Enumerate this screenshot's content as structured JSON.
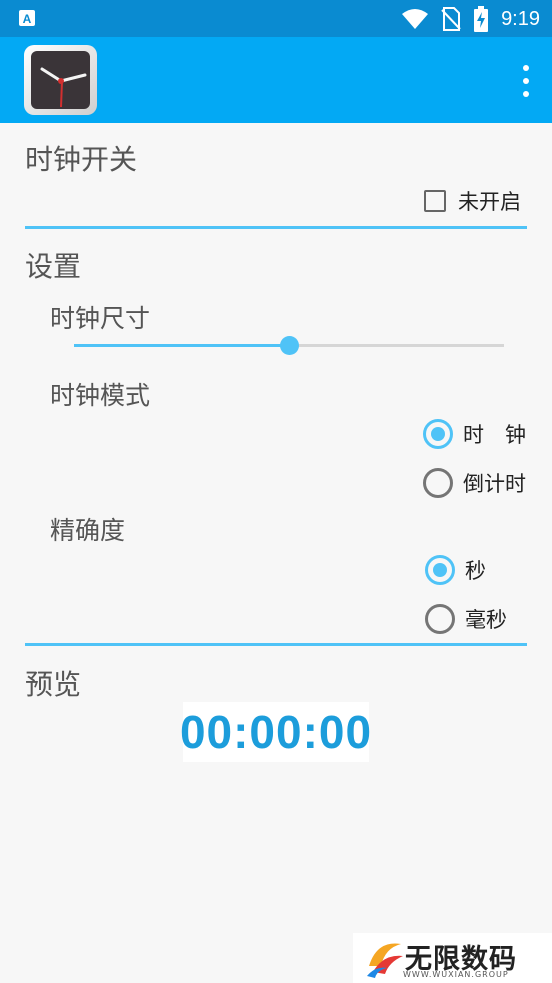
{
  "status_bar": {
    "time": "9:19",
    "icons": [
      "app-notification-icon",
      "wifi-icon",
      "no-sim-icon",
      "battery-charging-icon"
    ]
  },
  "app_bar": {
    "app_icon": "clock-app-icon",
    "overflow_icon": "more-vert-icon"
  },
  "clock_switch": {
    "title": "时钟开关",
    "checkbox_label": "未开启",
    "checked": false
  },
  "settings": {
    "title": "设置",
    "clock_size": {
      "label": "时钟尺寸",
      "value_fraction": 0.5
    },
    "clock_mode": {
      "label": "时钟模式",
      "options": [
        "时　钟",
        "倒计时"
      ],
      "selected_index": 0
    },
    "precision": {
      "label": "精确度",
      "options": [
        "秒",
        "毫秒"
      ],
      "selected_index": 0
    }
  },
  "preview": {
    "title": "预览",
    "time_text": "00:00:00"
  },
  "watermark": {
    "text": "无限数码",
    "sub": "WWW.WUXIAN.GROUP"
  },
  "colors": {
    "status_bar": "#0a8bd1",
    "app_bar": "#03a9f4",
    "accent": "#4fc3f7",
    "preview_text": "#1c9ddb"
  }
}
